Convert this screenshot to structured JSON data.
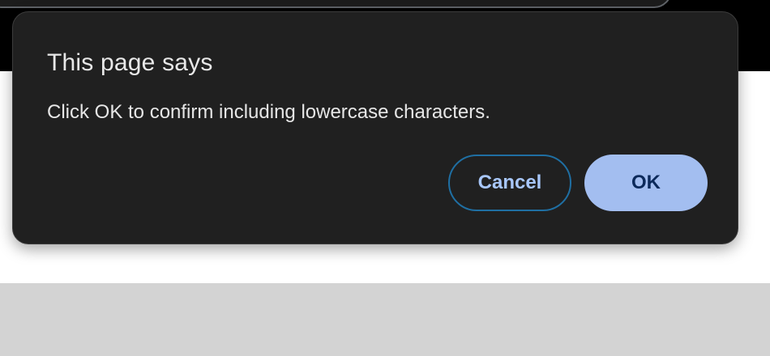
{
  "dialog": {
    "title": "This page says",
    "message": "Click OK to confirm including lowercase characters.",
    "cancel_label": "Cancel",
    "ok_label": "OK"
  },
  "colors": {
    "dialog_background": "#202020",
    "ok_button": "#a3bef0",
    "cancel_border": "#1f6fa3",
    "page_grey": "#d3d3d3"
  }
}
